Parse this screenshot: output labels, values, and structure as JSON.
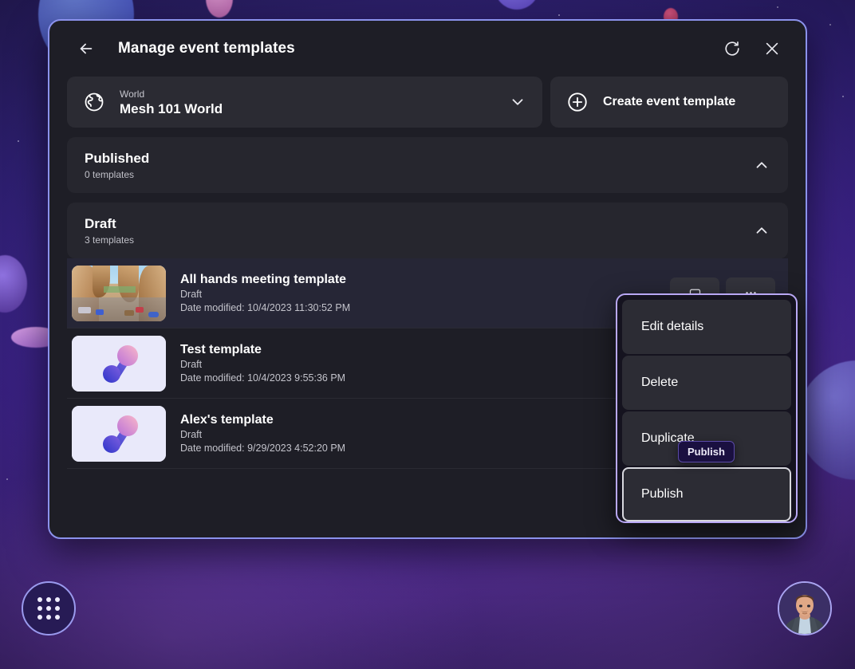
{
  "window": {
    "title": "Manage event templates",
    "back_icon": "back-arrow-icon",
    "refresh_icon": "refresh-icon",
    "close_icon": "close-icon"
  },
  "world_selector": {
    "icon": "globe-icon",
    "label": "World",
    "value": "Mesh 101 World",
    "chevron": "chevron-down-icon"
  },
  "create_button": {
    "icon": "plus-circle-icon",
    "label": "Create event template"
  },
  "sections": [
    {
      "title": "Published",
      "subtitle": "0 templates",
      "chevron": "chevron-up-icon",
      "expanded": true
    },
    {
      "title": "Draft",
      "subtitle": "3 templates",
      "chevron": "chevron-up-icon",
      "expanded": true
    }
  ],
  "templates": [
    {
      "name": "All hands meeting template",
      "state": "Draft",
      "date": "Date modified: 10/4/2023 11:30:52 PM",
      "thumbnail": "virtual-world-scene",
      "highlighted": true
    },
    {
      "name": "Test template",
      "state": "Draft",
      "date": "Date modified: 10/4/2023 9:55:36 PM",
      "thumbnail": "mesh-logo",
      "highlighted": false
    },
    {
      "name": "Alex's template",
      "state": "Draft",
      "date": "Date modified: 9/29/2023 4:52:20 PM",
      "thumbnail": "mesh-logo",
      "highlighted": false
    }
  ],
  "row_actions": {
    "info_icon": "info-icon",
    "more_icon": "more-options-icon"
  },
  "context_menu": {
    "items": [
      {
        "label": "Edit details",
        "focused": false
      },
      {
        "label": "Delete",
        "focused": false
      },
      {
        "label": "Duplicate",
        "focused": false
      },
      {
        "label": "Publish",
        "focused": true
      }
    ]
  },
  "tooltip": {
    "text": "Publish"
  },
  "taskbar": {
    "launcher_icon": "app-grid-icon",
    "avatar_icon": "user-avatar"
  },
  "colors": {
    "accent_border": "#8b92ec",
    "menu_border": "#b9a8f5",
    "panel_bg": "#1e1e26",
    "card_bg": "#2b2b33",
    "tooltip_bg": "#1a1040",
    "background_purple": "#3d2389"
  }
}
